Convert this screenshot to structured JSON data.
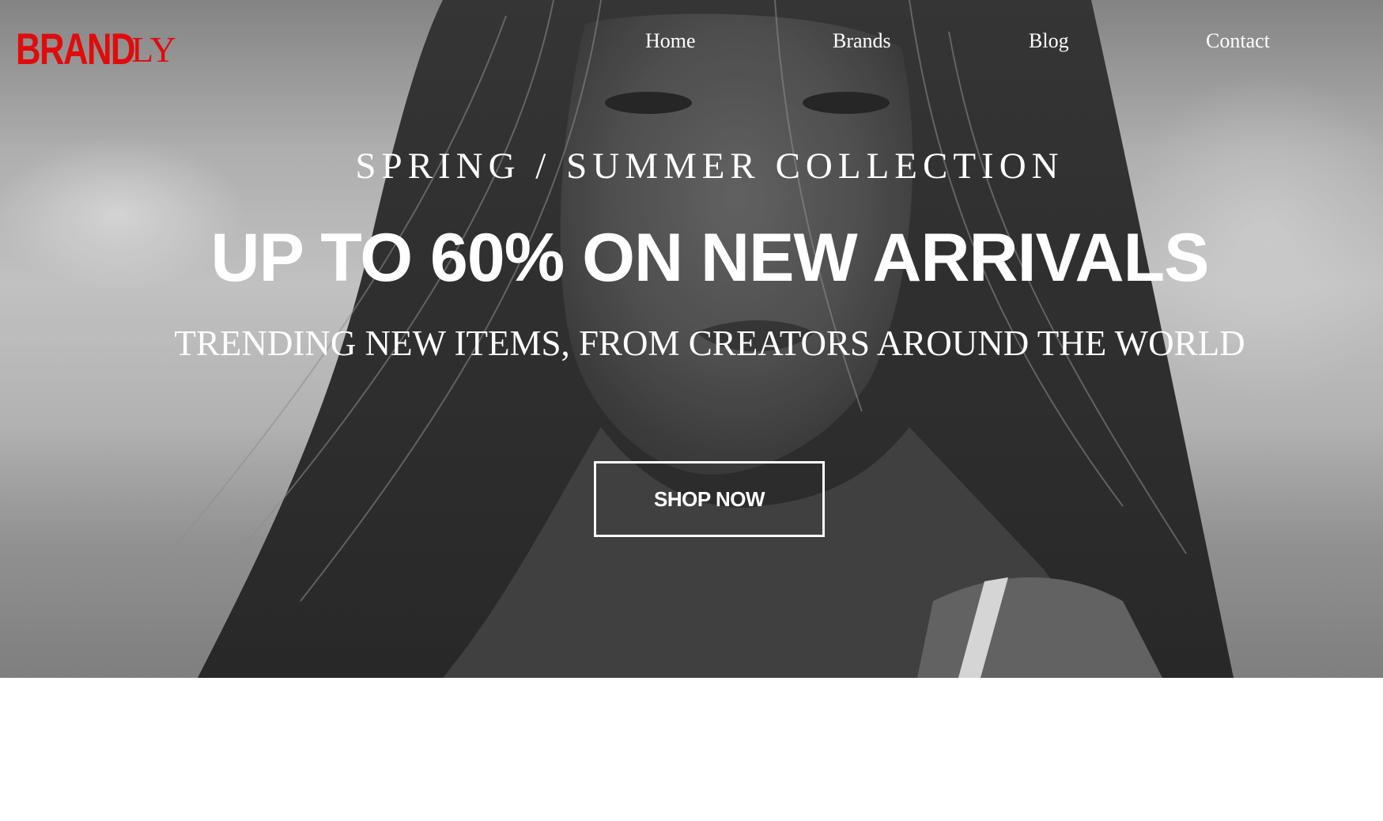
{
  "brand": {
    "logo_primary": "BRAND",
    "logo_secondary": "LY",
    "color": "#e10b0b"
  },
  "nav": {
    "items": [
      {
        "label": "Home"
      },
      {
        "label": "Brands"
      },
      {
        "label": "Blog"
      },
      {
        "label": "Contact"
      }
    ]
  },
  "hero": {
    "eyebrow": "SPRING / SUMMER COLLECTION",
    "headline": "UP TO 60% ON NEW ARRIVALS",
    "subline": "TRENDING NEW ITEMS, FROM CREATORS AROUND THE WORLD",
    "cta_label": "SHOP NOW",
    "image": "black-and-white-portrait-woman-windblown-hair"
  }
}
